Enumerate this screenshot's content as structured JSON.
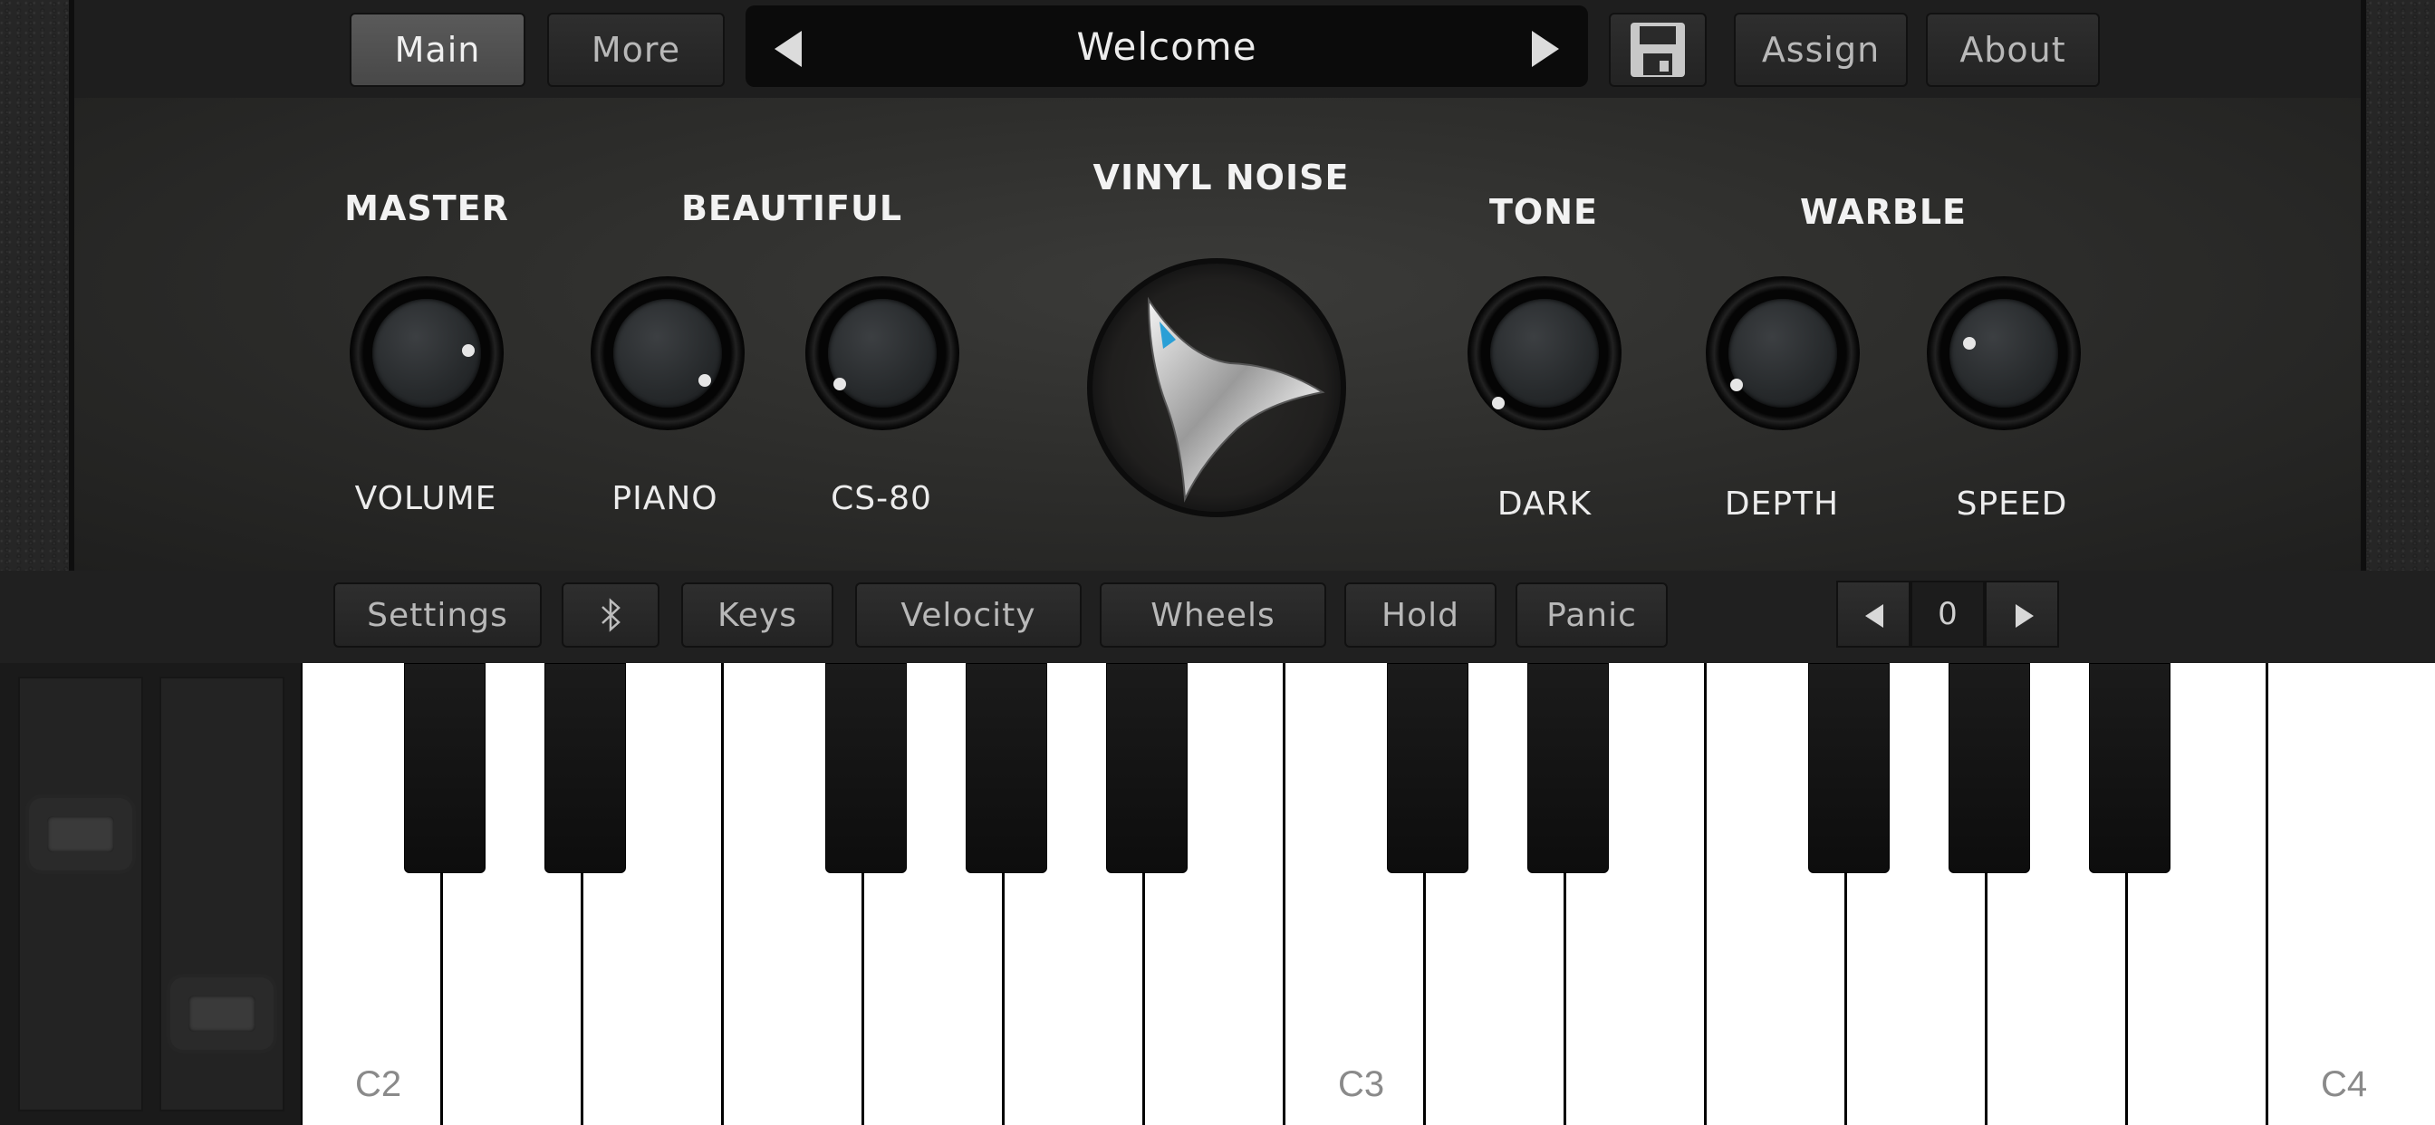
{
  "toolbar": {
    "main": "Main",
    "more": "More",
    "preset": "Welcome",
    "save_icon": "floppy-disk-icon",
    "assign": "Assign",
    "about": "About"
  },
  "controls": {
    "master": "MASTER",
    "beautiful": "BEAUTIFUL",
    "vinyl_noise": "VINYL NOISE",
    "tone": "TONE",
    "warble": "WARBLE",
    "volume": "VOLUME",
    "piano": "PIANO",
    "cs80": "CS-80",
    "dark": "DARK",
    "depth": "DEPTH",
    "speed": "SPEED"
  },
  "keyboard_bar": {
    "settings": "Settings",
    "bluetooth_icon": "bluetooth-icon",
    "keys": "Keys",
    "velocity": "Velocity",
    "wheels": "Wheels",
    "hold": "Hold",
    "panic": "Panic",
    "octave": "0"
  },
  "keys": {
    "c2": "C2",
    "c3": "C3",
    "c4": "C4"
  },
  "colors": {
    "accent": "#2a9fd6",
    "button_active": "#505050"
  }
}
